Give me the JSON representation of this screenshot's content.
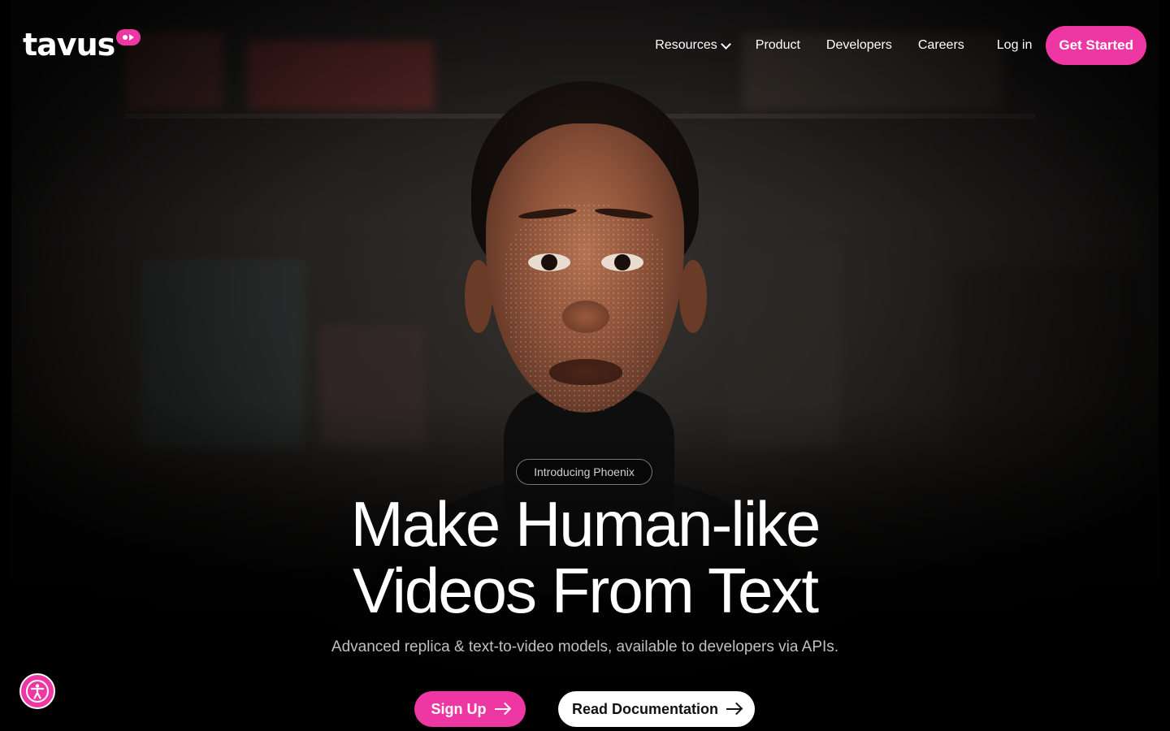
{
  "brand": {
    "name": "tavus",
    "accent": "#ef37a3"
  },
  "nav": {
    "items": [
      {
        "label": "Resources",
        "has_dropdown": true
      },
      {
        "label": "Product"
      },
      {
        "label": "Developers"
      },
      {
        "label": "Careers"
      }
    ],
    "login_label": "Log in",
    "cta_label": "Get Started"
  },
  "hero": {
    "pill_label": "Introducing Phoenix",
    "headline_line1": "Make Human-like",
    "headline_line2": "Videos From Text",
    "subheadline": "Advanced replica & text-to-video models, available to developers via APIs.",
    "signup_label": "Sign Up",
    "docs_label": "Read Documentation"
  },
  "icons": {
    "logo_badge": "play-badge-icon",
    "dropdown": "chevron-down-icon",
    "arrow": "arrow-right-icon",
    "accessibility": "accessibility-icon"
  }
}
